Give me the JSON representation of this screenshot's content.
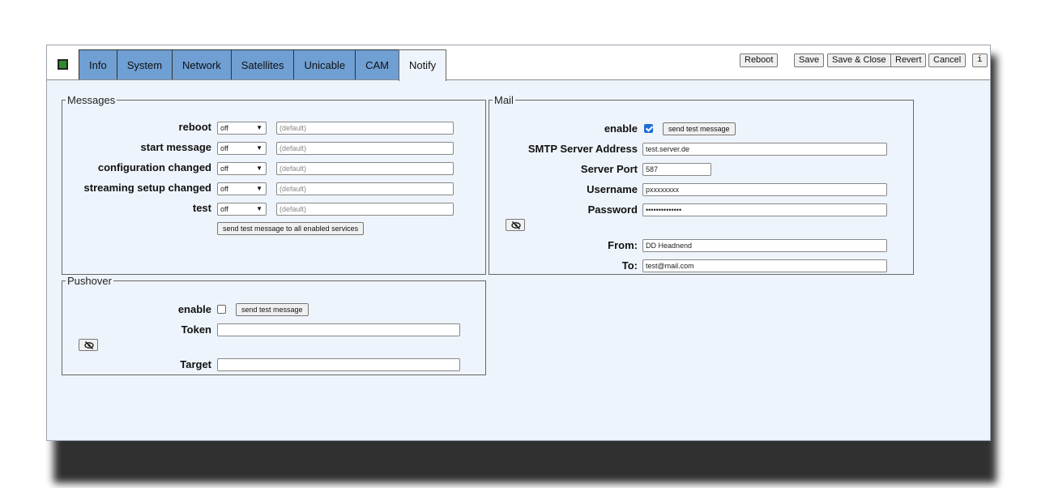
{
  "tabs": [
    "Info",
    "System",
    "Network",
    "Satellites",
    "Unicable",
    "CAM",
    "Notify"
  ],
  "active_tab": "Notify",
  "toolbar": {
    "reboot": "Reboot",
    "save": "Save",
    "save_close": "Save & Close",
    "revert": "Revert",
    "cancel": "Cancel",
    "info": "i"
  },
  "messages": {
    "legend": "Messages",
    "rows": [
      {
        "label": "reboot",
        "select": "off",
        "placeholder": "(default)"
      },
      {
        "label": "start message",
        "select": "off",
        "placeholder": "(default)"
      },
      {
        "label": "configuration changed",
        "select": "off",
        "placeholder": "(default)"
      },
      {
        "label": "streaming setup changed",
        "select": "off",
        "placeholder": "(default)"
      },
      {
        "label": "test",
        "select": "off",
        "placeholder": "(default)"
      }
    ],
    "send_all": "send test message to all enabled services"
  },
  "mail": {
    "legend": "Mail",
    "enable_label": "enable",
    "enabled": true,
    "send_test": "send test message",
    "smtp_label": "SMTP Server Address",
    "smtp_value": "test.server.de",
    "port_label": "Server Port",
    "port_value": "587",
    "user_label": "Username",
    "user_value": "pxxxxxxxx",
    "pass_label": "Password",
    "pass_value": "••••••••••••••",
    "from_label": "From:",
    "from_value": "DD Headnend",
    "to_label": "To:",
    "to_value": "test@mail.com"
  },
  "pushover": {
    "legend": "Pushover",
    "enable_label": "enable",
    "enabled": false,
    "send_test": "send test message",
    "token_label": "Token",
    "token_value": "",
    "target_label": "Target",
    "target_value": ""
  },
  "colors": {
    "tab_bg": "#6f9fd3",
    "panel_bg": "#eef4fb",
    "status_led": "#2e8b2e",
    "checkbox_on": "#1f6fd1"
  },
  "icons": {
    "status": "status-led-icon",
    "eye": "eye-slash-icon"
  }
}
